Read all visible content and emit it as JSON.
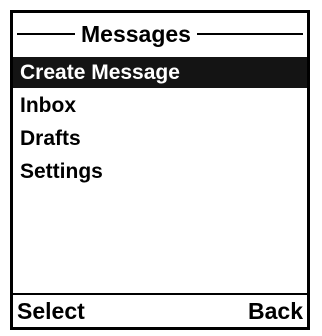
{
  "header": {
    "title": "Messages"
  },
  "menu": {
    "items": [
      {
        "label": "Create Message",
        "selected": true
      },
      {
        "label": "Inbox",
        "selected": false
      },
      {
        "label": "Drafts",
        "selected": false
      },
      {
        "label": "Settings",
        "selected": false
      }
    ]
  },
  "softkeys": {
    "left": "Select",
    "right": "Back"
  },
  "colors": {
    "highlight": "#141414",
    "foreground": "#000000",
    "background": "#ffffff"
  }
}
